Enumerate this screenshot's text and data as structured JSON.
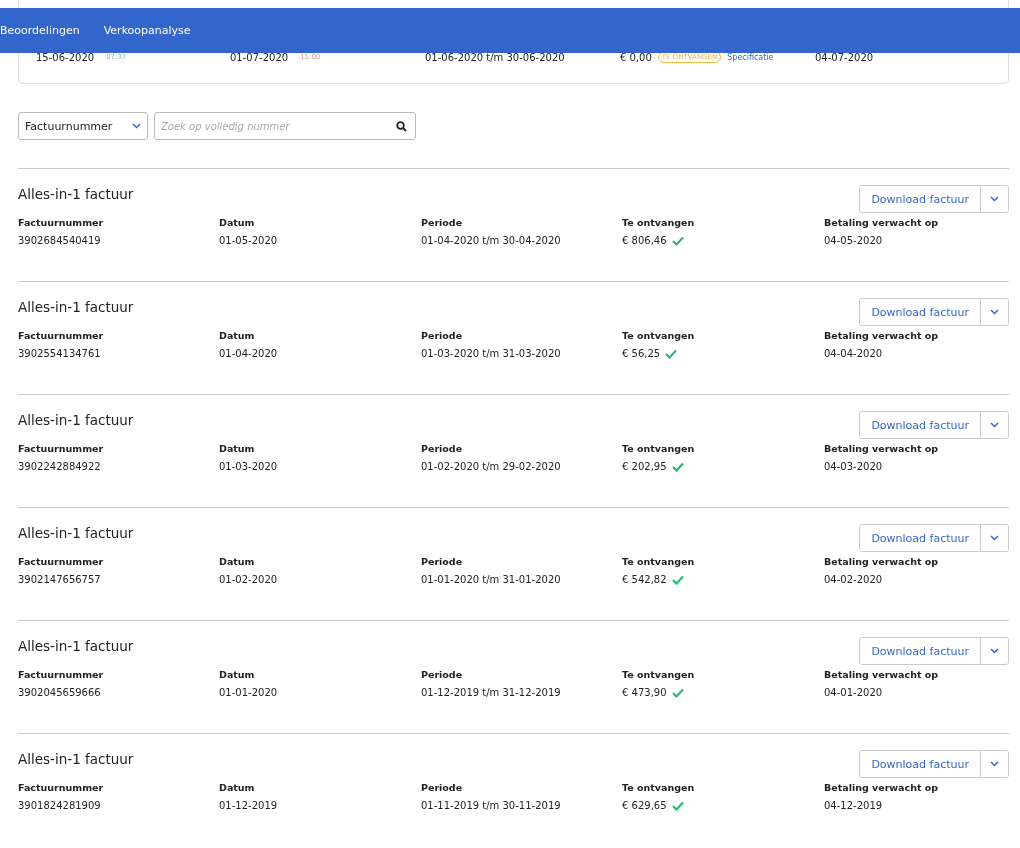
{
  "nav": {
    "tabs": [
      {
        "label": "Beoordelingen"
      },
      {
        "label": "Verkoopanalyse"
      }
    ]
  },
  "current_period": {
    "cells": [
      {
        "kind": "datetime",
        "value": "15-06-2020",
        "time": "07:37"
      },
      {
        "kind": "datetime",
        "value": "01-07-2020",
        "time": "11:00"
      },
      {
        "kind": "text",
        "value": "01-06-2020 t/m 30-06-2020"
      },
      {
        "kind": "amount",
        "value": "€ 0,00",
        "badge": "TE ONTVANGEN",
        "link": "Specificatie"
      },
      {
        "kind": "text",
        "value": "04-07-2020"
      }
    ]
  },
  "filter": {
    "select": "Factuurnummer",
    "placeholder": "Zoek op volledig nummer"
  },
  "invoices": [
    {
      "title": "Alles-in-1 factuur",
      "button": "Download factuur",
      "fields": [
        {
          "label": "Factuurnummer",
          "value": "3902684540419"
        },
        {
          "label": "Datum",
          "value": "01-05-2020"
        },
        {
          "label": "Periode",
          "value": "01-04-2020 t/m 30-04-2020"
        },
        {
          "label": "Te ontvangen",
          "value": "€ 806,46",
          "paid": true
        },
        {
          "label": "Betaling verwacht op",
          "value": "04-05-2020"
        }
      ]
    },
    {
      "title": "Alles-in-1 factuur",
      "button": "Download factuur",
      "fields": [
        {
          "label": "Factuurnummer",
          "value": "3902554134761"
        },
        {
          "label": "Datum",
          "value": "01-04-2020"
        },
        {
          "label": "Periode",
          "value": "01-03-2020 t/m 31-03-2020"
        },
        {
          "label": "Te ontvangen",
          "value": "€ 56,25",
          "paid": true
        },
        {
          "label": "Betaling verwacht op",
          "value": "04-04-2020"
        }
      ]
    },
    {
      "title": "Alles-in-1 factuur",
      "button": "Download factuur",
      "fields": [
        {
          "label": "Factuurnummer",
          "value": "3902242884922"
        },
        {
          "label": "Datum",
          "value": "01-03-2020"
        },
        {
          "label": "Periode",
          "value": "01-02-2020 t/m 29-02-2020"
        },
        {
          "label": "Te ontvangen",
          "value": "€ 202,95",
          "paid": true
        },
        {
          "label": "Betaling verwacht op",
          "value": "04-03-2020"
        }
      ]
    },
    {
      "title": "Alles-in-1 factuur",
      "button": "Download factuur",
      "fields": [
        {
          "label": "Factuurnummer",
          "value": "3902147656757"
        },
        {
          "label": "Datum",
          "value": "01-02-2020"
        },
        {
          "label": "Periode",
          "value": "01-01-2020 t/m 31-01-2020"
        },
        {
          "label": "Te ontvangen",
          "value": "€ 542,82",
          "paid": true
        },
        {
          "label": "Betaling verwacht op",
          "value": "04-02-2020"
        }
      ]
    },
    {
      "title": "Alles-in-1 factuur",
      "button": "Download factuur",
      "fields": [
        {
          "label": "Factuurnummer",
          "value": "3902045659666"
        },
        {
          "label": "Datum",
          "value": "01-01-2020"
        },
        {
          "label": "Periode",
          "value": "01-12-2019 t/m 31-12-2019"
        },
        {
          "label": "Te ontvangen",
          "value": "€ 473,90",
          "paid": true
        },
        {
          "label": "Betaling verwacht op",
          "value": "04-01-2020"
        }
      ]
    },
    {
      "title": "Alles-in-1 factuur",
      "button": "Download factuur",
      "fields": [
        {
          "label": "Factuurnummer",
          "value": "3901824281909"
        },
        {
          "label": "Datum",
          "value": "01-12-2019"
        },
        {
          "label": "Periode",
          "value": "01-11-2019 t/m 30-11-2019"
        },
        {
          "label": "Te ontvangen",
          "value": "€ 629,65",
          "paid": true
        },
        {
          "label": "Betaling verwacht op",
          "value": "04-12-2019"
        }
      ]
    }
  ]
}
